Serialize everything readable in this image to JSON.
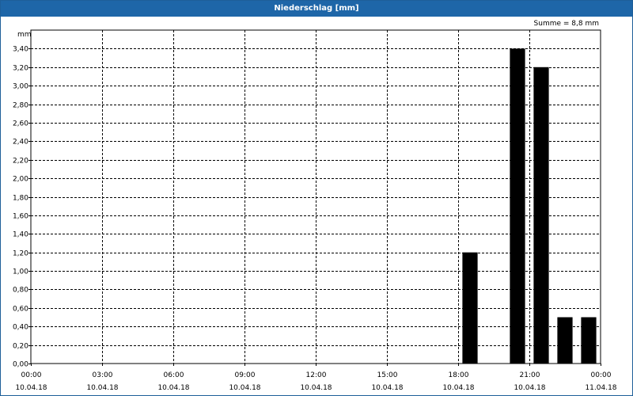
{
  "window": {
    "title": "Niederschlag [mm]"
  },
  "summary": {
    "label": "Summe = 8,8 mm"
  },
  "chart_data": {
    "type": "bar",
    "title": "Niederschlag [mm]",
    "ylabel": "mm",
    "xlabel": "",
    "ylim": [
      0,
      3.6
    ],
    "yticks": [
      "0,00",
      "0,20",
      "0,40",
      "0,60",
      "0,80",
      "1,00",
      "1,20",
      "1,40",
      "1,60",
      "1,80",
      "2,00",
      "2,20",
      "2,40",
      "2,60",
      "2,80",
      "3,00",
      "3,20",
      "3,40"
    ],
    "xrange_hours": [
      0,
      24
    ],
    "xticks": [
      {
        "time": "00:00",
        "date": "10.04.18"
      },
      {
        "time": "03:00",
        "date": "10.04.18"
      },
      {
        "time": "06:00",
        "date": "10.04.18"
      },
      {
        "time": "09:00",
        "date": "10.04.18"
      },
      {
        "time": "12:00",
        "date": "10.04.18"
      },
      {
        "time": "15:00",
        "date": "10.04.18"
      },
      {
        "time": "18:00",
        "date": "10.04.18"
      },
      {
        "time": "21:00",
        "date": "10.04.18"
      },
      {
        "time": "00:00",
        "date": "11.04.18"
      }
    ],
    "bars": [
      {
        "start": "18:00",
        "end": "19:00",
        "value": 1.2
      },
      {
        "start": "20:00",
        "end": "21:00",
        "value": 3.4
      },
      {
        "start": "21:00",
        "end": "22:00",
        "value": 3.2
      },
      {
        "start": "22:00",
        "end": "23:00",
        "value": 0.5
      },
      {
        "start": "23:00",
        "end": "00:00",
        "value": 0.5
      }
    ],
    "grid": true,
    "bar_color": "#000000"
  }
}
